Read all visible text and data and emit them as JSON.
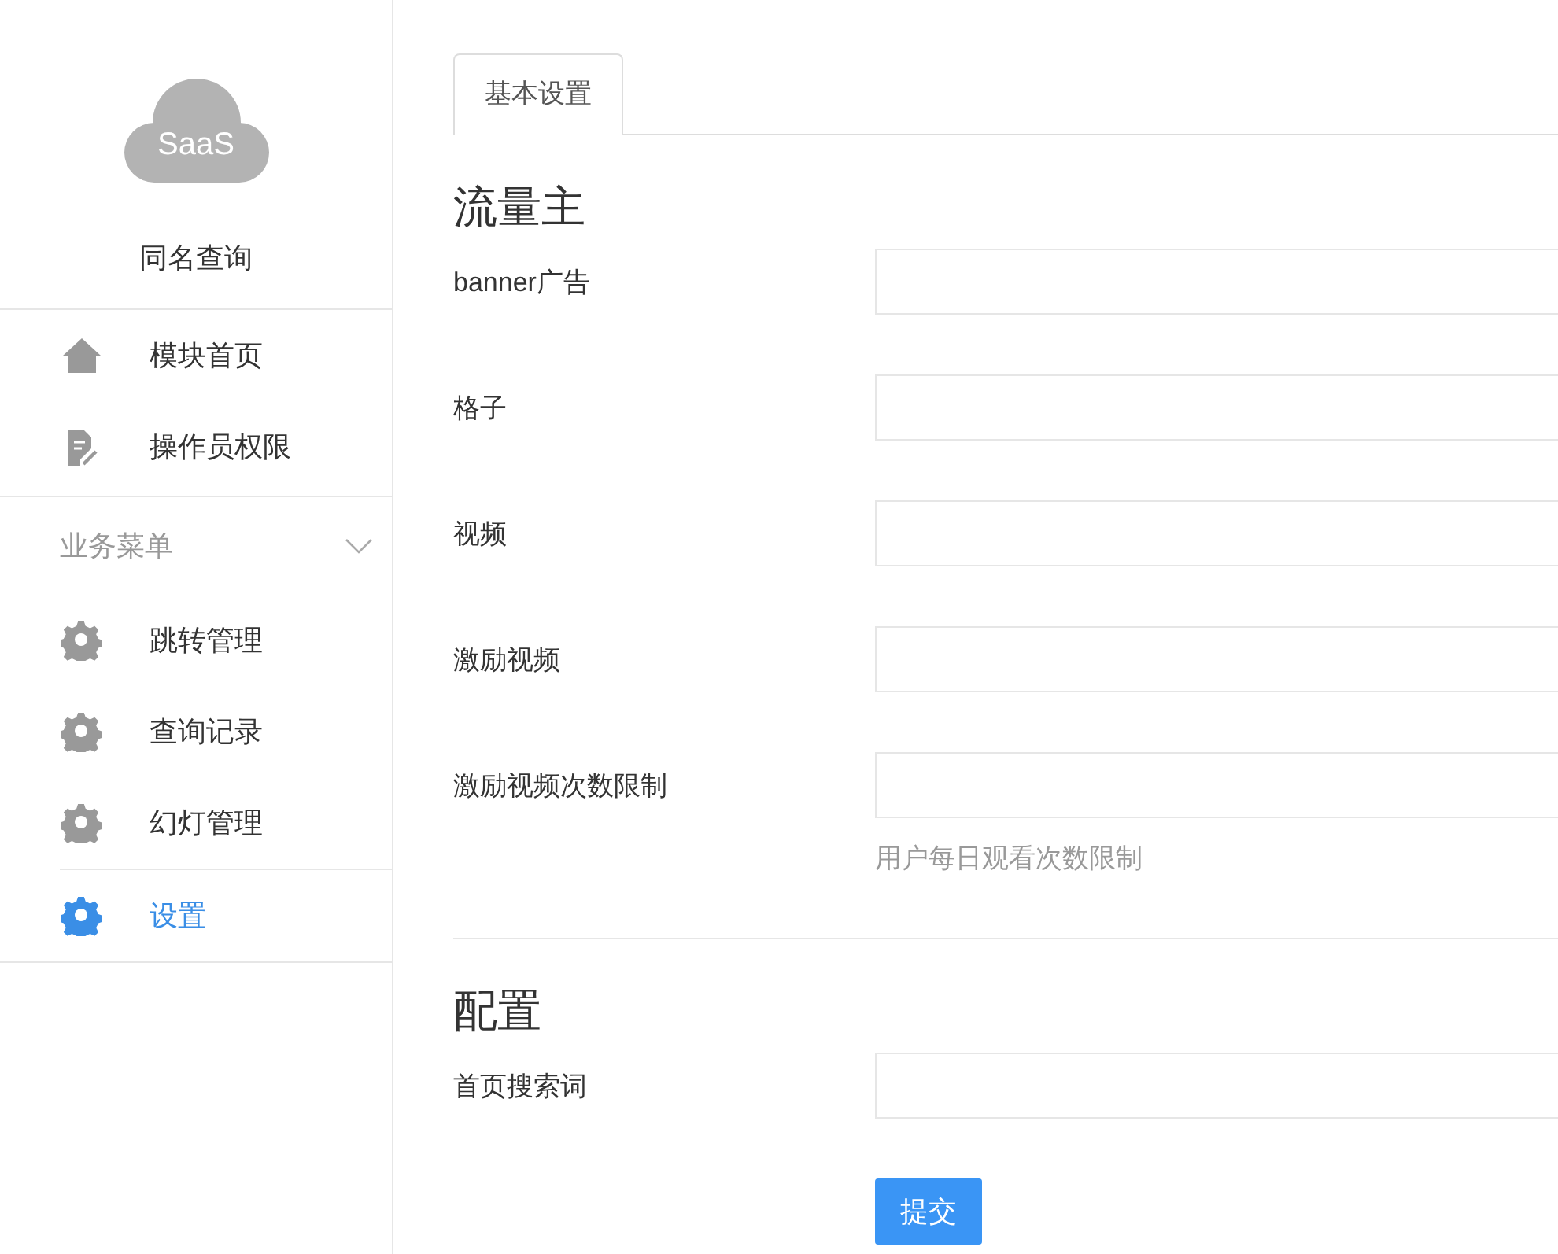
{
  "sidebar": {
    "logo_text": "SaaS",
    "app_name": "同名查询",
    "nav_items": [
      {
        "label": "模块首页",
        "kind": "home"
      },
      {
        "label": "操作员权限",
        "kind": "document"
      }
    ],
    "group": {
      "title": "业务菜单",
      "expanded": true,
      "items": [
        {
          "label": "跳转管理",
          "kind": "gear",
          "selected": false
        },
        {
          "label": "查询记录",
          "kind": "gear",
          "selected": false
        },
        {
          "label": "幻灯管理",
          "kind": "gear",
          "selected": false
        },
        {
          "label": "设置",
          "kind": "gear",
          "selected": true
        }
      ]
    }
  },
  "tabs": [
    {
      "label": "基本设置",
      "selected": true
    }
  ],
  "sections": [
    {
      "title": "流量主",
      "fields": [
        {
          "label": "banner广告"
        },
        {
          "label": "格子"
        },
        {
          "label": "视频"
        },
        {
          "label": "激励视频"
        },
        {
          "label": "激励视频次数限制",
          "hint": "用户每日观看次数限制"
        }
      ]
    },
    {
      "title": "配置",
      "fields": [
        {
          "label": "首页搜索词"
        }
      ]
    }
  ],
  "submit_button": "提交"
}
